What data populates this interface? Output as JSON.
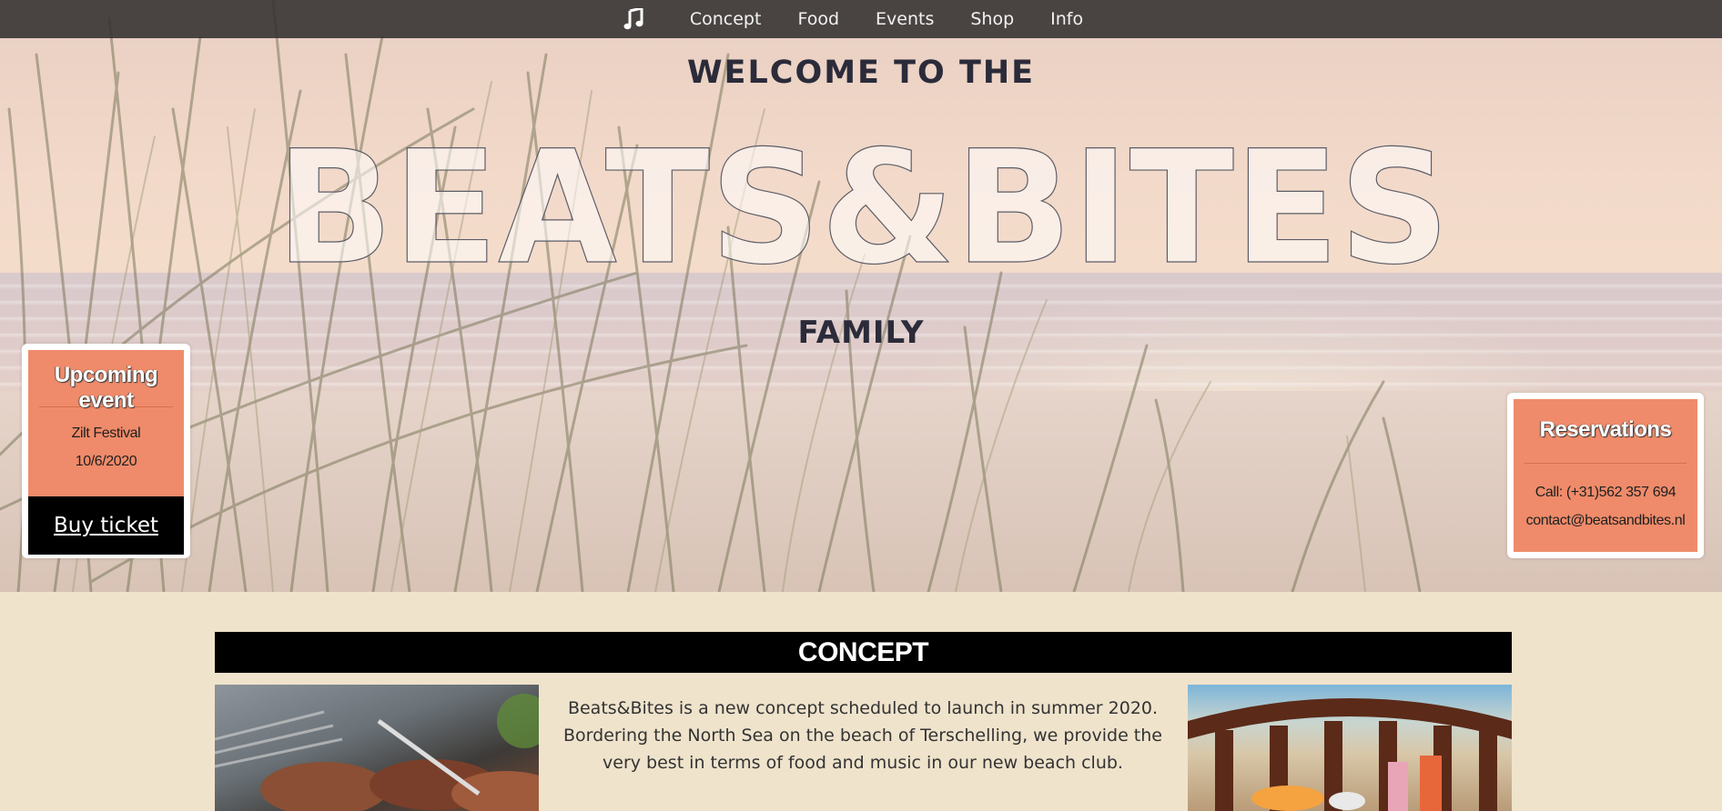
{
  "nav": {
    "icon": "music-note-icon",
    "items": [
      "Concept",
      "Food",
      "Events",
      "Shop",
      "Info"
    ]
  },
  "hero": {
    "welcome": "WELCOME TO THE",
    "title": "BEATS&BITES",
    "family": "FAMILY"
  },
  "event_card": {
    "title": "Upcoming event",
    "name": "Zilt Festival",
    "date": "10/6/2020",
    "button": "Buy ticket"
  },
  "reservations_card": {
    "title": "Reservations",
    "phone": "Call: (+31)562 357 694",
    "email": "contact@beatsandbites.nl"
  },
  "concept": {
    "heading": "CONCEPT",
    "text": "Beats&Bites is a new concept scheduled to launch in summer 2020. Bordering the North Sea on the beach of Terschelling, we provide the very best in terms of food and music in our new beach club."
  },
  "colors": {
    "accent": "#ef8b6a",
    "nav_bg": "#323030",
    "page_bg": "#efe3cc"
  }
}
